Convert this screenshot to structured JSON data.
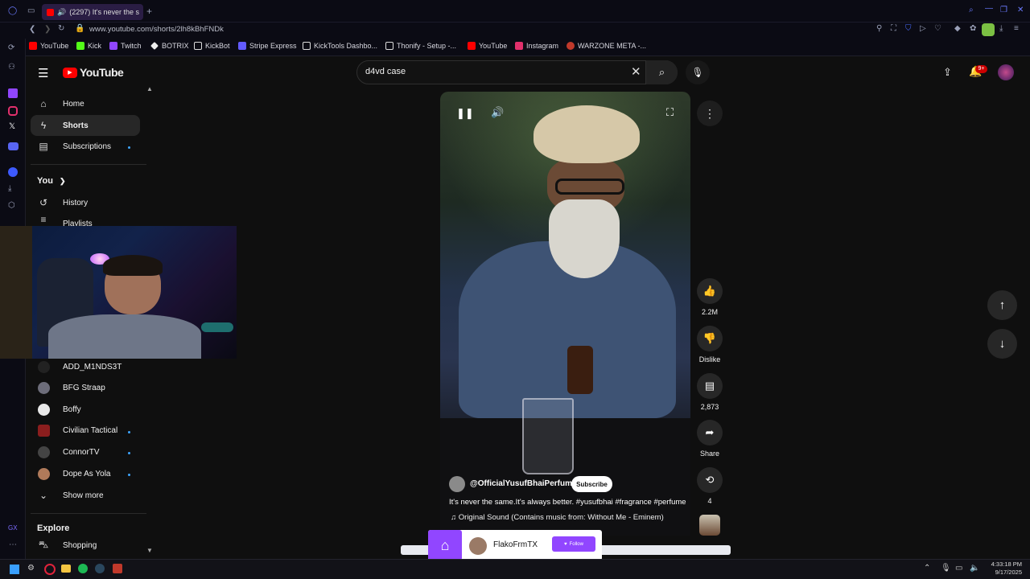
{
  "browser": {
    "tab_title": "(2297) It's never the s",
    "url": "www.youtube.com/shorts/2lh8kBhFNDk",
    "bookmarks": [
      {
        "label": "YouTube",
        "color": "#ff0000"
      },
      {
        "label": "Kick",
        "color": "#53fc18"
      },
      {
        "label": "Twitch",
        "color": "#9146ff"
      },
      {
        "label": "BOTRIX",
        "color": "#ffffff"
      },
      {
        "label": "KickBot",
        "color": "#ffffff"
      },
      {
        "label": "Stripe Express",
        "color": "#635bff"
      },
      {
        "label": "KickTools Dashbo...",
        "color": "#ffffff"
      },
      {
        "label": "Thonify - Setup -...",
        "color": "#ffffff"
      },
      {
        "label": "YouTube",
        "color": "#ff0000"
      },
      {
        "label": "Instagram",
        "color": "#e1306c"
      },
      {
        "label": "WARZONE META -...",
        "color": "#c0392b"
      }
    ]
  },
  "youtube": {
    "logo_text": "YouTube",
    "search_value": "d4vd case",
    "notification_count": "9+",
    "sidebar": {
      "main": [
        {
          "label": "Home",
          "icon": "home-icon"
        },
        {
          "label": "Shorts",
          "icon": "shorts-icon",
          "active": true
        },
        {
          "label": "Subscriptions",
          "icon": "subscriptions-icon"
        }
      ],
      "you_header": "You",
      "you_items": [
        {
          "label": "History",
          "icon": "history-icon"
        },
        {
          "label": "Playlists",
          "icon": "playlists-icon"
        }
      ],
      "subscriptions": [
        {
          "label": "ADD_M1NDS3T",
          "color": "#222"
        },
        {
          "label": "BFG Straap",
          "color": "#6d6d7a"
        },
        {
          "label": "Boffy",
          "color": "#e8e8e8"
        },
        {
          "label": "Civilian Tactical",
          "color": "#8b1e1e"
        },
        {
          "label": "ConnorTV",
          "color": "#444"
        },
        {
          "label": "Dope As Yola",
          "color": "#b07a5a"
        }
      ],
      "show_more": "Show more",
      "explore_header": "Explore",
      "explore_items": [
        {
          "label": "Shopping",
          "icon": "shopping-icon"
        }
      ]
    },
    "short": {
      "channel": "@OfficialYusufBhaiPerfumer",
      "subscribe_label": "Subscribe",
      "caption": "It's never the same.It's always better. #yusufbhai #fragrance #perfume",
      "sound": "Original Sound (Contains music from: Without Me - Eminem)",
      "likes": "2.2M",
      "dislike_label": "Dislike",
      "comments": "2,873",
      "share_label": "Share",
      "remix_count": "4"
    }
  },
  "overlay": {
    "twitch_name": "FlakoFrmTX",
    "follow_label": "Follow"
  },
  "taskbar": {
    "time": "4:33:18 PM",
    "date": "9/17/2025"
  }
}
